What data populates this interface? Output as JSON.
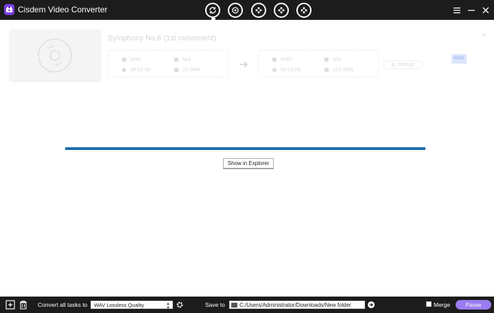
{
  "app": {
    "title": "Cisdem Video Converter"
  },
  "titlebar": {
    "modes": [
      "convert-icon",
      "rip-icon",
      "film-reel-icon",
      "film-reel-icon",
      "film-reel-icon"
    ],
    "controls": [
      "menu-icon",
      "minimize-icon",
      "close-icon"
    ]
  },
  "task": {
    "title": "Symphony No.6 (1st movement)",
    "source": {
      "format": "M4A",
      "resolution": "N/A",
      "duration": "00:12:08",
      "size": "21.0MB"
    },
    "output": {
      "format": "WAV",
      "resolution": "N/A",
      "duration": "00:12:08",
      "size": "122.0MB"
    },
    "settings_label": "Settings",
    "badge_text": "WAV"
  },
  "progress": {
    "fraction": 1.0
  },
  "show_in_explorer_label": "Show in Explorer",
  "bottombar": {
    "convert_all_label": "Convert all tasks to",
    "format_selected": "WAV Lossless Quality",
    "save_to_label": "Save to",
    "save_path": "C:/Users/Administrator/Downloads/New folder",
    "merge_label": "Merge",
    "pause_label": "Pause"
  },
  "colors": {
    "accent": "#9a7cf0",
    "progress": "#1f6db0",
    "bar": "#1c1c1c"
  }
}
